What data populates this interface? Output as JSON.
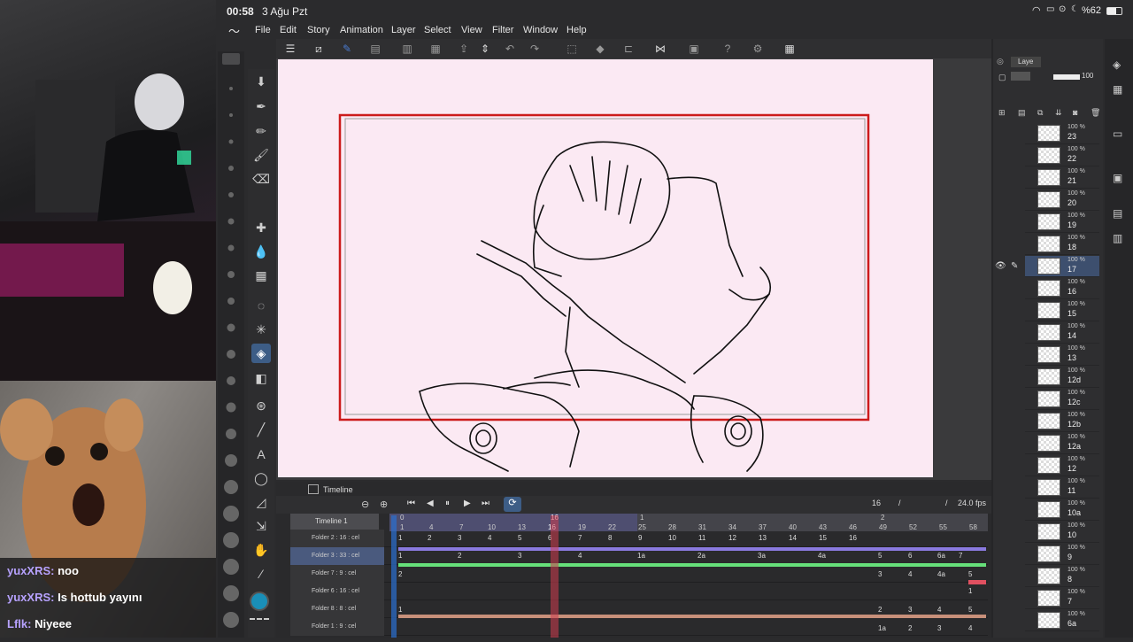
{
  "status": {
    "time": "00:58",
    "date": "3 Ağu Pzt",
    "battery": "%62"
  },
  "menu": [
    "File",
    "Edit",
    "Story",
    "Animation",
    "Layer",
    "Select",
    "View",
    "Filter",
    "Window",
    "Help"
  ],
  "chat": [
    {
      "user": "yuxXRS:",
      "text": "noo"
    },
    {
      "user": "yuxXRS:",
      "text": "Is hottub yayını"
    },
    {
      "user": "Lflk:",
      "text": "Niyeee"
    }
  ],
  "timeline": {
    "tab_label": "Timeline",
    "name": "Timeline 1",
    "current_frame": "16",
    "slash1": "/",
    "slash2": "/",
    "fps": "24.0 fps",
    "header_top": [
      "0",
      "",
      "16",
      "",
      "1",
      "",
      "",
      "",
      "",
      "",
      "",
      "",
      "",
      "",
      "2"
    ],
    "header_numbers": [
      "1",
      "4",
      "7",
      "10",
      "13",
      "16",
      "19",
      "22",
      "25",
      "28",
      "31",
      "34",
      "37",
      "40",
      "43",
      "46",
      "49",
      "52",
      "55",
      "58"
    ],
    "tracks": [
      {
        "name": "Folder 2 : 16 : cel",
        "frames": [
          "1",
          "2",
          "3",
          "4",
          "5",
          "6",
          "7",
          "8",
          "9",
          "10",
          "11",
          "12",
          "13",
          "14",
          "15",
          "16"
        ]
      },
      {
        "name": "Folder 3 : 33 : cel",
        "frames": [
          "1",
          "2",
          "3",
          "4",
          "1a",
          "2a",
          "3a",
          "4a",
          "5",
          "6",
          "6a",
          "7"
        ]
      },
      {
        "name": "Folder 7 : 9 : cel",
        "frames": [
          "2",
          "3",
          "4",
          "4a",
          "5"
        ]
      },
      {
        "name": "Folder 6 : 16 : cel",
        "frames": [
          "1"
        ]
      },
      {
        "name": "Folder 8 : 8 : cel",
        "frames": [
          "1",
          "2",
          "3",
          "4",
          "5"
        ]
      },
      {
        "name": "Folder 1 : 9 : cel",
        "frames": [
          "1a",
          "2",
          "3",
          "4"
        ]
      }
    ]
  },
  "layers": {
    "tab_label": "Laye",
    "opacity": "100",
    "items": [
      {
        "pct": "100 %",
        "name": "23"
      },
      {
        "pct": "100 %",
        "name": "22"
      },
      {
        "pct": "100 %",
        "name": "21"
      },
      {
        "pct": "100 %",
        "name": "20"
      },
      {
        "pct": "100 %",
        "name": "19"
      },
      {
        "pct": "100 %",
        "name": "18"
      },
      {
        "pct": "100 %",
        "name": "17"
      },
      {
        "pct": "100 %",
        "name": "16"
      },
      {
        "pct": "100 %",
        "name": "15"
      },
      {
        "pct": "100 %",
        "name": "14"
      },
      {
        "pct": "100 %",
        "name": "13"
      },
      {
        "pct": "100 %",
        "name": "12d"
      },
      {
        "pct": "100 %",
        "name": "12c"
      },
      {
        "pct": "100 %",
        "name": "12b"
      },
      {
        "pct": "100 %",
        "name": "12a"
      },
      {
        "pct": "100 %",
        "name": "12"
      },
      {
        "pct": "100 %",
        "name": "11"
      },
      {
        "pct": "100 %",
        "name": "10a"
      },
      {
        "pct": "100 %",
        "name": "10"
      },
      {
        "pct": "100 %",
        "name": "9"
      },
      {
        "pct": "100 %",
        "name": "8"
      },
      {
        "pct": "100 %",
        "name": "7"
      },
      {
        "pct": "100 %",
        "name": "6a"
      }
    ]
  },
  "colors": {
    "accent": "#3d5d86",
    "playhead": "#d03c50",
    "frame_border": "#cc1b1b",
    "canvas": "#fbe9f3"
  }
}
